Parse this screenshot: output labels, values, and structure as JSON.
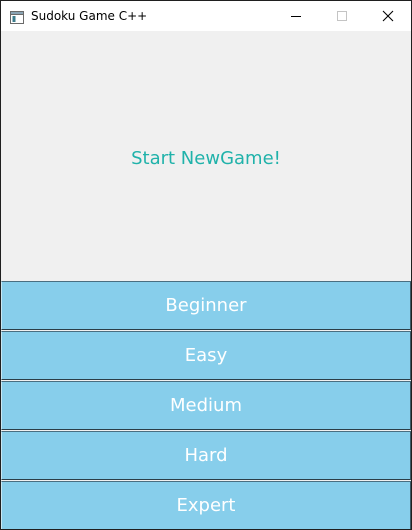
{
  "window": {
    "title": "Sudoku Game C++",
    "app_icon": "window-app-icon",
    "controls": {
      "minimize_icon": "minimize-icon",
      "maximize_icon": "maximize-icon",
      "close_icon": "close-icon"
    }
  },
  "main": {
    "headline": "Start NewGame!",
    "headline_color": "#20b2aa"
  },
  "difficulty_buttons": [
    {
      "label": "Beginner"
    },
    {
      "label": "Easy"
    },
    {
      "label": "Medium"
    },
    {
      "label": "Hard"
    },
    {
      "label": "Expert"
    }
  ],
  "colors": {
    "button_background": "#87ceeb",
    "button_text": "#ffffff",
    "window_background": "#f0f0f0"
  }
}
